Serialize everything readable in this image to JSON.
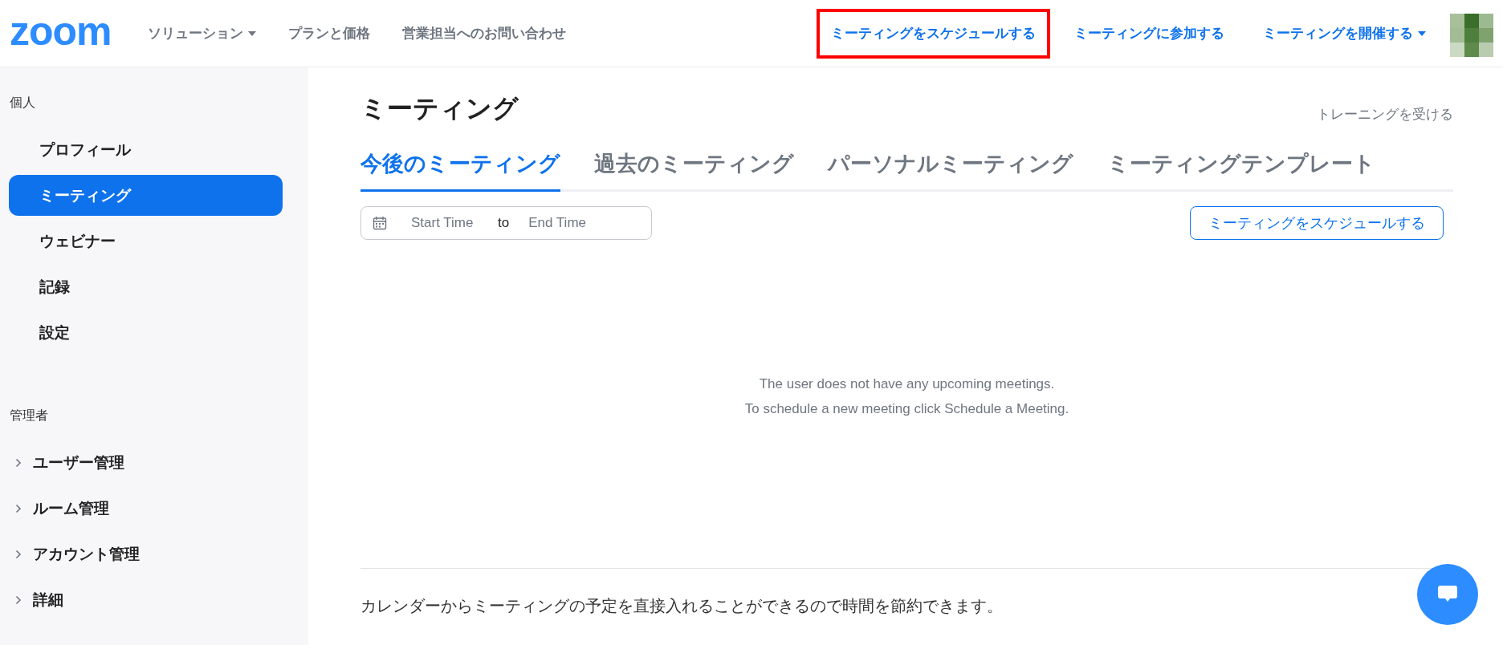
{
  "header": {
    "logo": "zoom",
    "nav_left": [
      {
        "label": "ソリューション",
        "dropdown": true
      },
      {
        "label": "プランと価格",
        "dropdown": false
      },
      {
        "label": "営業担当へのお問い合わせ",
        "dropdown": false
      }
    ],
    "nav_right": [
      {
        "label": "ミーティングをスケジュールする",
        "dropdown": false,
        "highlighted": true
      },
      {
        "label": "ミーティングに参加する",
        "dropdown": false,
        "highlighted": false
      },
      {
        "label": "ミーティングを開催する",
        "dropdown": true,
        "highlighted": false
      }
    ]
  },
  "sidebar": {
    "sections": [
      {
        "title": "個人",
        "items": [
          {
            "label": "プロフィール",
            "selected": false,
            "expandable": false
          },
          {
            "label": "ミーティング",
            "selected": true,
            "expandable": false
          },
          {
            "label": "ウェビナー",
            "selected": false,
            "expandable": false
          },
          {
            "label": "記録",
            "selected": false,
            "expandable": false
          },
          {
            "label": "設定",
            "selected": false,
            "expandable": false
          }
        ]
      },
      {
        "title": "管理者",
        "items": [
          {
            "label": "ユーザー管理",
            "selected": false,
            "expandable": true
          },
          {
            "label": "ルーム管理",
            "selected": false,
            "expandable": true
          },
          {
            "label": "アカウント管理",
            "selected": false,
            "expandable": true
          },
          {
            "label": "詳細",
            "selected": false,
            "expandable": true
          }
        ]
      }
    ]
  },
  "main": {
    "title": "ミーティング",
    "training_link": "トレーニングを受ける",
    "tabs": [
      {
        "label": "今後のミーティング",
        "selected": true
      },
      {
        "label": "過去のミーティング",
        "selected": false
      },
      {
        "label": "パーソナルミーティング",
        "selected": false
      },
      {
        "label": "ミーティングテンプレート",
        "selected": false
      }
    ],
    "date_range": {
      "start_placeholder": "Start Time",
      "separator": "to",
      "end_placeholder": "End Time"
    },
    "schedule_button": "ミーティングをスケジュールする",
    "empty_message": [
      "The user does not have any upcoming meetings.",
      "To schedule a new meeting click Schedule a Meeting."
    ],
    "footer_text": "カレンダーからミーティングの予定を直接入れることができるので時間を節約できます。"
  }
}
